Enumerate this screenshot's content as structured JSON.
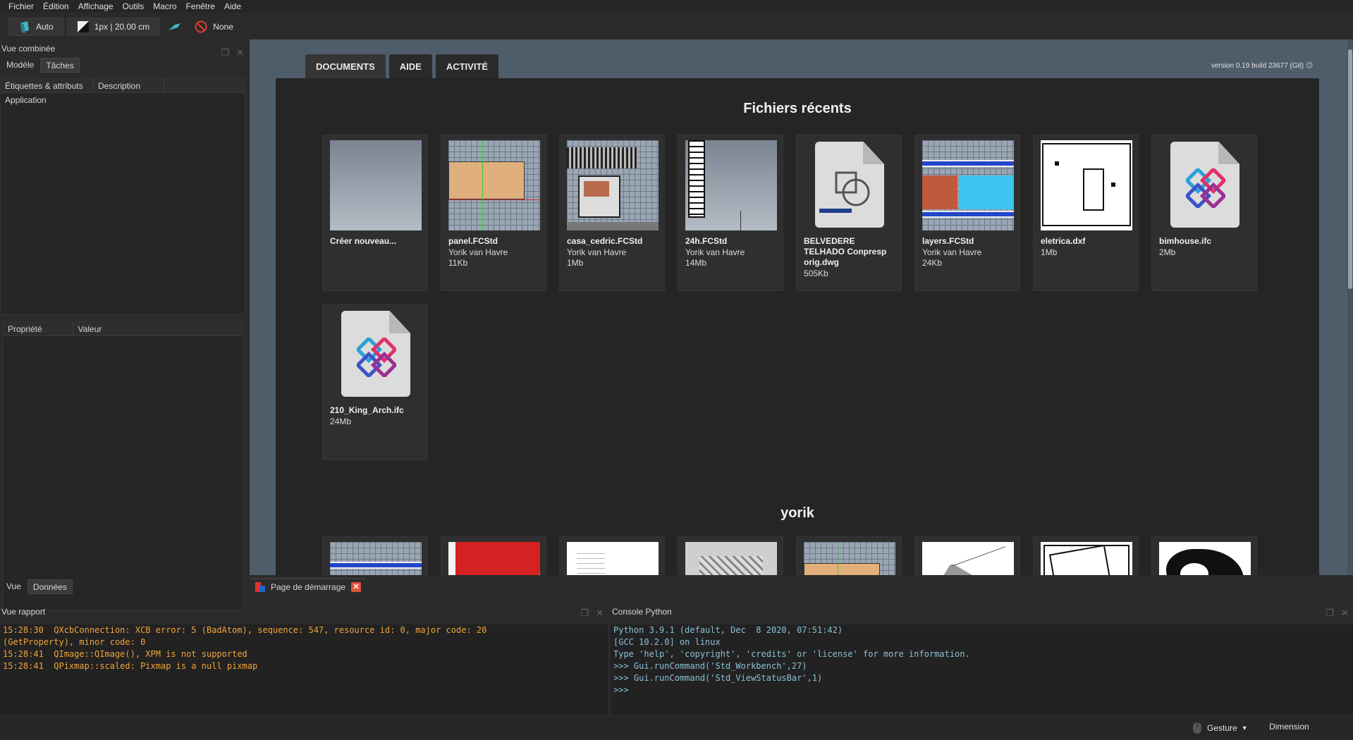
{
  "menu": [
    "Fichier",
    "Édition",
    "Affichage",
    "Outils",
    "Macro",
    "Fenêtre",
    "Aide"
  ],
  "toolbar": {
    "auto_label": "Auto",
    "line_label": "1px | 20.00 cm",
    "none_label": "None"
  },
  "combo_view": {
    "title": "Vue combinée",
    "tabs": [
      "Modèle",
      "Tâches"
    ],
    "tree_columns": [
      "Étiquettes & attributs",
      "Description"
    ],
    "tree_items": [
      "Application"
    ],
    "property_columns": [
      "Propriété",
      "Valeur"
    ],
    "bottom_tabs": [
      "Vue",
      "Données"
    ]
  },
  "start_page": {
    "tabs": [
      "DOCUMENTS",
      "AIDE",
      "ACTIVITÉ"
    ],
    "version": "version 0.19 build 23677 (Git)",
    "recent_title": "Fichiers récents",
    "recent_files": [
      {
        "name": "Créer nouveau...",
        "author": "",
        "size": ""
      },
      {
        "name": "panel.FCStd",
        "author": "Yorik van Havre",
        "size": "11Kb"
      },
      {
        "name": "casa_cedric.FCStd",
        "author": "Yorik van Havre",
        "size": "1Mb"
      },
      {
        "name": "24h.FCStd",
        "author": "Yorik van Havre",
        "size": "14Mb"
      },
      {
        "name": "BELVEDERE TELHADO Conpresp orig.dwg",
        "author": "",
        "size": "505Kb"
      },
      {
        "name": "layers.FCStd",
        "author": "Yorik van Havre",
        "size": "24Kb"
      },
      {
        "name": "eletrica.dxf",
        "author": "",
        "size": "1Mb"
      },
      {
        "name": "bimhouse.ifc",
        "author": "",
        "size": "2Mb"
      },
      {
        "name": "210_King_Arch.ifc",
        "author": "",
        "size": "24Mb"
      }
    ],
    "folder_title": "yorik"
  },
  "document_tab": {
    "label": "Page de démarrage"
  },
  "report_view": {
    "title": "Vue rapport",
    "lines": [
      "15:28:30  QXcbConnection: XCB error: 5 (BadAtom), sequence: 547, resource id: 0, major code: 20",
      "(GetProperty), minor code: 0",
      "15:28:41  QImage::QImage(), XPM is not supported",
      "15:28:41  QPixmap::scaled: Pixmap is a null pixmap"
    ]
  },
  "python_console": {
    "title": "Console Python",
    "lines": [
      "Python 3.9.1 (default, Dec  8 2020, 07:51:42)",
      "[GCC 10.2.0] on linux",
      "Type 'help', 'copyright', 'credits' or 'license' for more information.",
      ">>> Gui.runCommand('Std_Workbench',27)",
      ">>> Gui.runCommand('Std_ViewStatusBar',1)",
      ">>> "
    ]
  },
  "statusbar": {
    "navigation": "Gesture",
    "units": "Dimension"
  },
  "colors": {
    "report_text": "#f0a43a",
    "console_text": "#8cc0d8",
    "startpage_bg": "#4f5d6b"
  }
}
